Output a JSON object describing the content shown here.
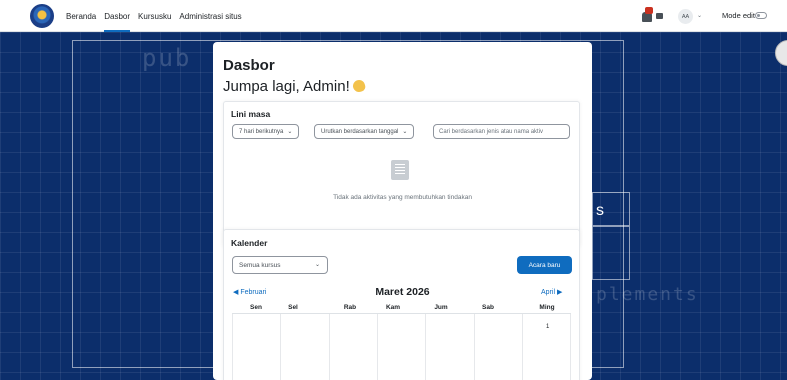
{
  "nav": {
    "items": [
      {
        "label": "Beranda",
        "active": false
      },
      {
        "label": "Dasbor",
        "active": true
      },
      {
        "label": "Kursusku",
        "active": false
      },
      {
        "label": "Administrasi situs",
        "active": false
      }
    ],
    "avatar_initials": "AA",
    "edit_mode_label": "Mode edit",
    "edit_mode_on": false
  },
  "background": {
    "word_left": "pub",
    "letter_s": "s",
    "word_right": "plements"
  },
  "page": {
    "title": "Dasbor",
    "greeting": "Jumpa lagi, Admin!"
  },
  "timeline": {
    "title": "Lini masa",
    "range_select": "7 hari berikutnya",
    "sort_select": "Urutkan berdasarkan tanggal",
    "search_placeholder": "Cari berdasarkan jenis atau nama aktiv",
    "empty_message": "Tidak ada aktivitas yang membutuhkan tindakan"
  },
  "calendar": {
    "title": "Kalender",
    "course_select": "Semua kursus",
    "new_event_label": "Acara baru",
    "prev_month": "Februari",
    "current_month": "Maret 2026",
    "next_month": "April",
    "weekdays": [
      "Sen",
      "Sel",
      "Rab",
      "Kam",
      "Jum",
      "Sab",
      "Ming"
    ],
    "visible_day": "1"
  },
  "colors": {
    "primary": "#0f6cbf",
    "background": "#0c2e6b",
    "badge": "#ca3120"
  }
}
